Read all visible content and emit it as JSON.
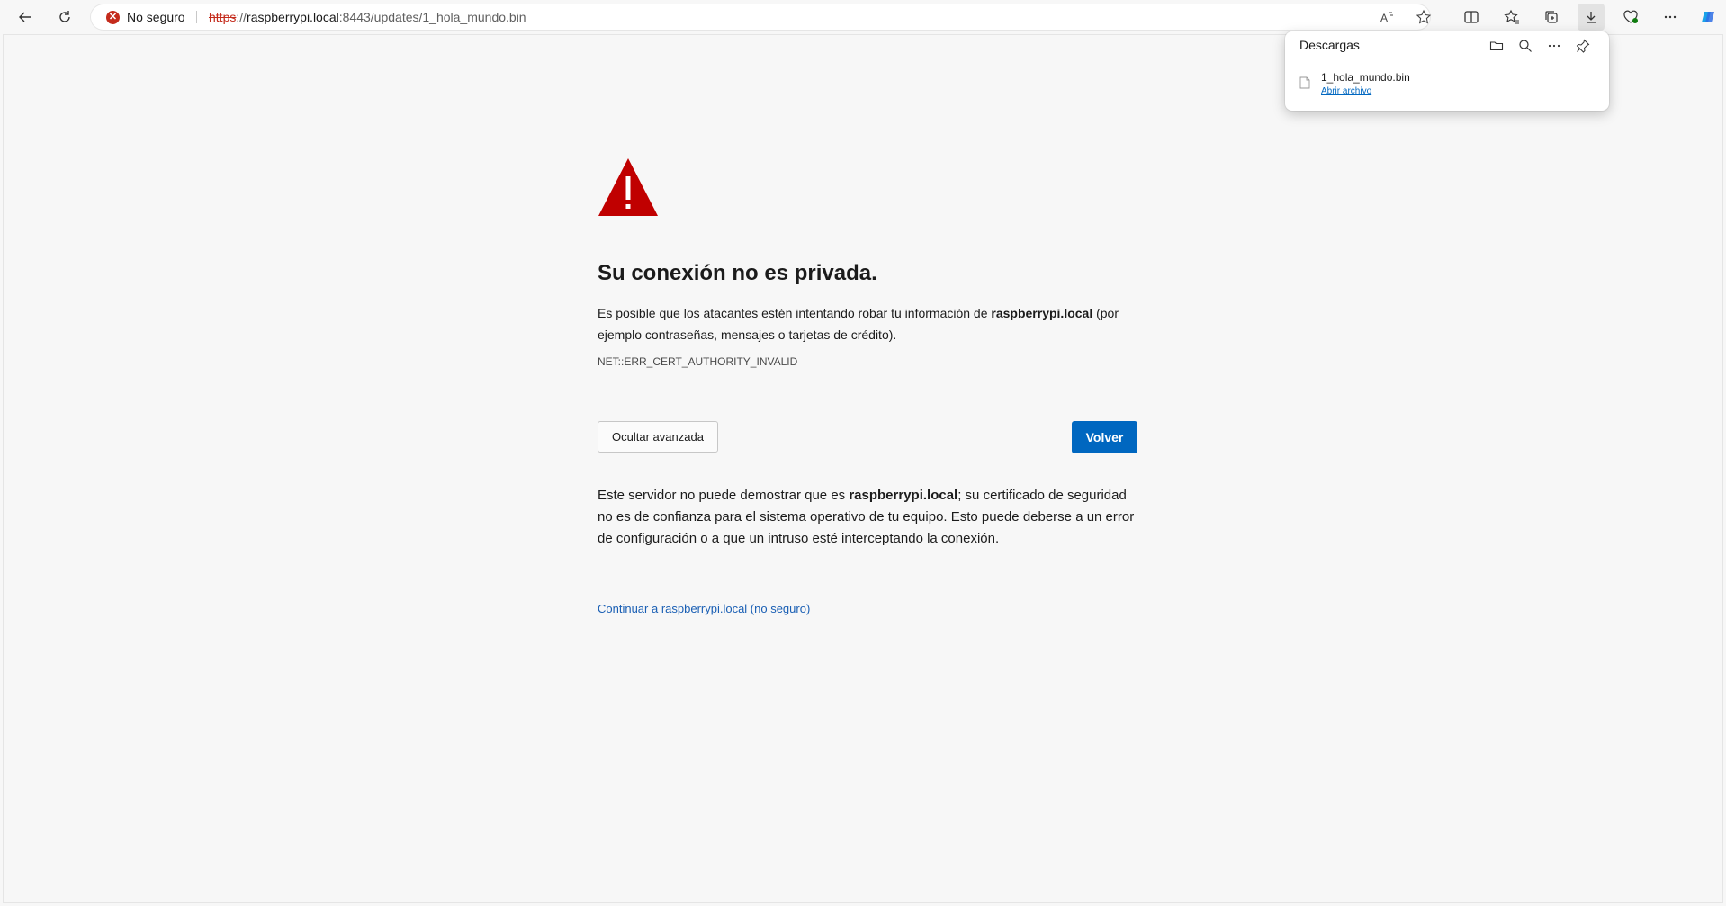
{
  "browser": {
    "security_label": "No seguro",
    "url": {
      "scheme": "https",
      "separator": "://",
      "host": "raspberrypi.local",
      "rest": ":8443/updates/1_hola_mundo.bin"
    }
  },
  "downloads": {
    "title": "Descargas",
    "file_name": "1_hola_mundo.bin",
    "open_link": "Abrir archivo"
  },
  "error_page": {
    "heading": "Su conexión no es privada.",
    "intro_prefix": "Es posible que los atacantes estén intentando robar tu información de ",
    "intro_host": "raspberrypi.local",
    "intro_suffix": " (por ejemplo contraseñas, mensajes o tarjetas de crédito).",
    "error_code": "NET::ERR_CERT_AUTHORITY_INVALID",
    "advanced_button": "Ocultar avanzada",
    "back_button": "Volver",
    "detail_prefix": "Este servidor no puede demostrar que es ",
    "detail_host": "raspberrypi.local",
    "detail_suffix": "; su certificado de seguridad no es de confianza para el sistema operativo de tu equipo. Esto puede deberse a un error de configuración o a que un intruso esté interceptando la conexión.",
    "proceed_link": "Continuar a raspberrypi.local (no seguro)"
  },
  "colors": {
    "accent": "#0067c0",
    "danger": "#c42b1c",
    "warning_icon": "#c00000"
  }
}
